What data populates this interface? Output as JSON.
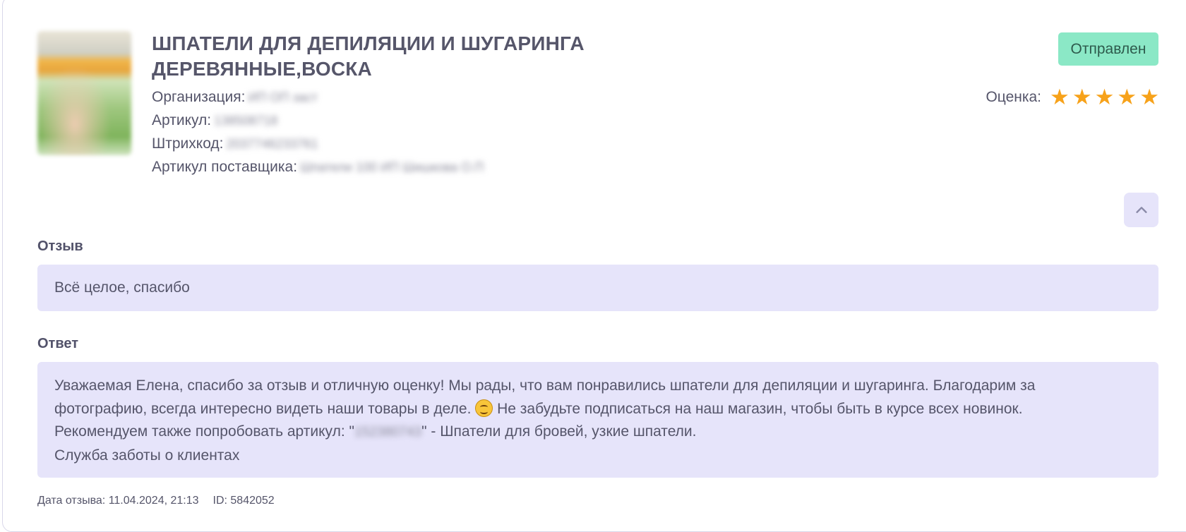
{
  "product": {
    "title": "ШПАТЕЛИ ДЛЯ ДЕПИЛЯЦИИ И ШУГАРИНГА ДЕРЕВЯННЫЕ,ВОСКА",
    "organization_label": "Организация:",
    "organization_value": "ИП ОП заст",
    "article_label": "Артикул:",
    "article_value": "138508718",
    "barcode_label": "Штрихкод:",
    "barcode_value": "2037746233761",
    "supplier_article_label": "Артикул поставщика:",
    "supplier_article_value": "Шпатели 100 ИП Шишкова О.П"
  },
  "status": "Отправлен",
  "rating": {
    "label": "Оценка:",
    "stars": 5,
    "max": 5,
    "star_color": "#f7a21a"
  },
  "review": {
    "label": "Отзыв",
    "text": "Всё целое, спасибо"
  },
  "answer": {
    "label": "Ответ",
    "line1": "Уважаемая Елена, спасибо за отзыв и отличную оценку! Мы рады, что вам понравились шпатели для депиляции и шугаринга. Благодарим за",
    "line2_before": "фотографию, всегда интересно видеть наши товары в деле.",
    "line2_after": "Не забудьте подписаться на наш магазин, чтобы быть в курсе всех новинок.",
    "line3_before": "Рекомендуем также попробовать артикул: \"",
    "line3_hidden": "152380743",
    "line3_after": "\" - Шпатели для бровей, узкие шпатели.",
    "line4": "Служба заботы о клиентах"
  },
  "footer": {
    "date": "Дата отзыва: 11.04.2024, 21:13",
    "id": "ID: 5842052"
  },
  "colors": {
    "status_bg": "#8be8c6",
    "box_bg": "#e6e4fa",
    "border": "#d9d7ea"
  },
  "icons": {
    "collapse": "chevron-up-icon",
    "emoji": "smiling-face-icon"
  }
}
